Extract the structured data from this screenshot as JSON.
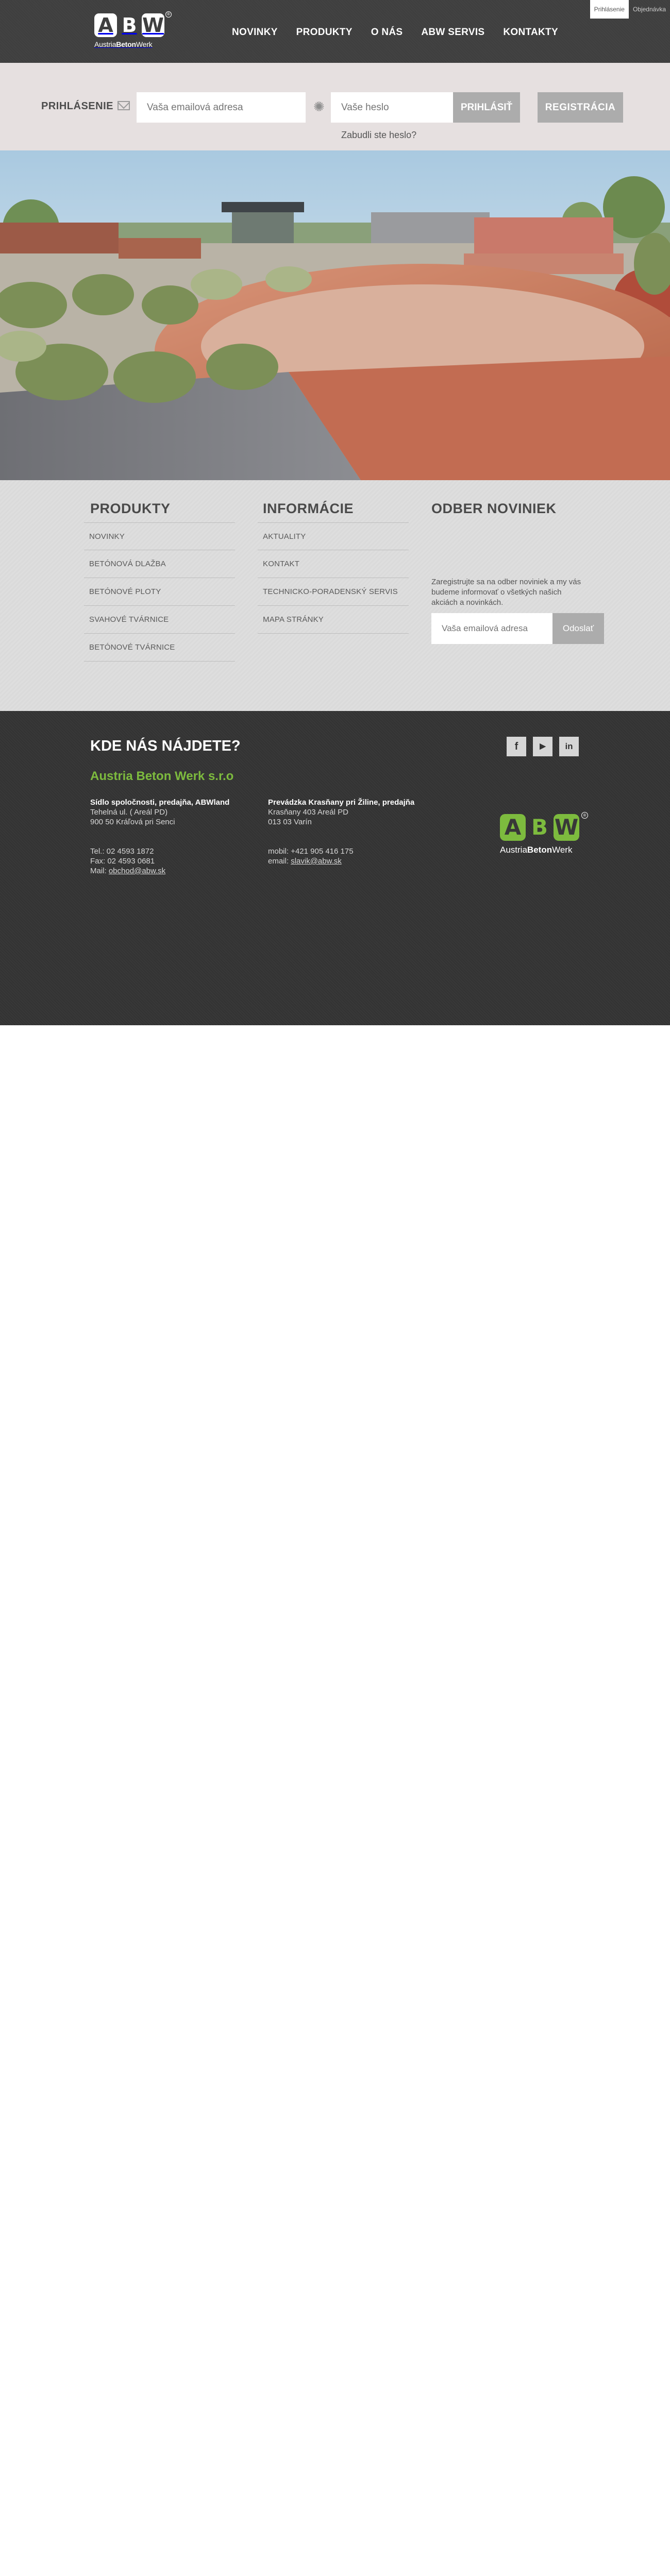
{
  "top_links": {
    "login": "Prihlásenie",
    "order": "Objednávka"
  },
  "logo": {
    "letter_a": "A",
    "letter_b": "B",
    "letter_w": "W",
    "reg_mark": "®",
    "word_austria": "Austria",
    "word_beton": "Beton",
    "word_werk": "Werk"
  },
  "nav": [
    "NOVINKY",
    "PRODUKTY",
    "O NÁS",
    "ABW SERVIS",
    "KONTAKTY"
  ],
  "login_bar": {
    "label": "PRIHLÁSENIE",
    "email_placeholder": "Vaša emailová adresa",
    "password_placeholder": "Vaše heslo",
    "login_button": "PRIHLÁSIŤ",
    "register_button": "REGISTRÁCIA",
    "forgot_link": "Zabudli ste heslo?",
    "mail_icon": "mail-icon",
    "password_icon": "gear-icon"
  },
  "hero": {
    "image": "paved-garden-photo"
  },
  "footer_columns": {
    "products": {
      "title": "PRODUKTY",
      "items": [
        "NOVINKY",
        "BETÓNOVÁ DLAŽBA",
        "BETÓNOVÉ PLOTY",
        "SVAHOVÉ TVÁRNICE",
        "BETÓNOVÉ TVÁRNICE"
      ]
    },
    "info": {
      "title": "INFORMÁCIE",
      "items": [
        "AKTUALITY",
        "KONTAKT",
        "TECHNICKO-PORADENSKÝ SERVIS",
        "MAPA STRÁNKY"
      ]
    },
    "newsletter": {
      "title": "ODBER NOVINIEK",
      "text": "Zaregistrujte sa na odber noviniek a my vás budeme informovať o všetkých našich akciách a novinkách.",
      "placeholder": "Vaša emailová adresa",
      "button": "Odoslať"
    }
  },
  "dark_footer": {
    "heading": "KDE NÁS NÁJDETE?",
    "company": "Austria Beton Werk s.r.o",
    "address_left": {
      "title": "Sídlo spoločnosti, predajňa, ABWland",
      "line1": "Tehelná ul. ( Areál PD)",
      "line2": "900 50 Kráľová pri Senci",
      "tel": "Tel.: 02 4593 1872",
      "fax": "Fax: 02 4593 0681",
      "mail_label": "Mail: ",
      "mail": "obchod@abw.sk"
    },
    "address_right": {
      "title": "Prevádzka Krasňany pri Žiline, predajňa",
      "line1": "Krasňany 403 Areál PD",
      "line2": "013 03 Varín",
      "mobile": "mobil: +421 905 416 175",
      "email_label": "email: ",
      "email": "slavik@abw.sk"
    },
    "social": [
      {
        "icon": "facebook-icon",
        "glyph": "f"
      },
      {
        "icon": "youtube-icon",
        "glyph": "▶"
      },
      {
        "icon": "linkedin-icon",
        "glyph": "in"
      }
    ],
    "logo_word_austria": "Austria",
    "logo_word_beton": "Beton",
    "logo_word_werk": "Werk"
  },
  "colors": {
    "brand_green": "#7dbb3e",
    "header_dark": "#404040",
    "button_grey": "#acacac",
    "login_bg": "#e6e0e0"
  }
}
